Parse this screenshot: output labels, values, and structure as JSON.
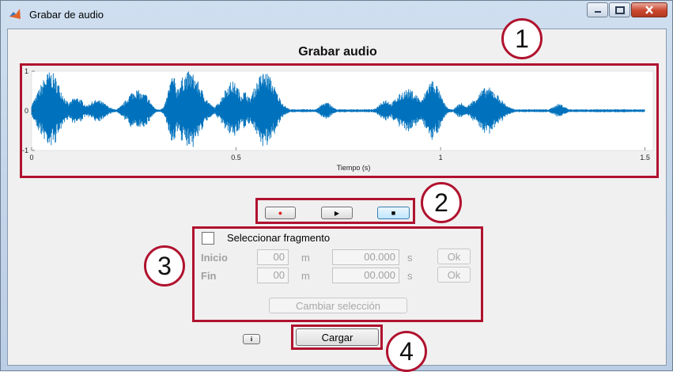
{
  "window": {
    "title": "Grabar de audio"
  },
  "panel": {
    "title": "Grabar  audio"
  },
  "plot": {
    "xlabel": "Tiempo (s)",
    "x_ticks": [
      "0",
      "0.5",
      "1",
      "1.5"
    ],
    "y_ticks": [
      "1",
      "0",
      "-1"
    ],
    "xlim": [
      0,
      1.52
    ],
    "ylim": [
      -1,
      1
    ],
    "color": "#0072BD"
  },
  "annotations": [
    "1",
    "2",
    "3",
    "4"
  ],
  "transport": {
    "record": {
      "icon": "record-dot",
      "symbol": "●",
      "color": "#e02020"
    },
    "play": {
      "icon": "play-triangle",
      "symbol": "▶"
    },
    "stop": {
      "icon": "stop-square",
      "symbol": "■"
    }
  },
  "selection": {
    "checkbox_label": "Seleccionar fragmento",
    "checked": false,
    "start": {
      "label": "Inicio",
      "minutes": "00",
      "min_unit": "m",
      "seconds": "00.000",
      "sec_unit": "s",
      "ok": "Ok"
    },
    "end": {
      "label": "Fin",
      "minutes": "00",
      "min_unit": "m",
      "seconds": "00.000",
      "sec_unit": "s",
      "ok": "Ok"
    },
    "change_button": "Cambiar selección"
  },
  "info_button": {
    "icon": "info-icon",
    "symbol": "i"
  },
  "load_button": "Cargar"
}
